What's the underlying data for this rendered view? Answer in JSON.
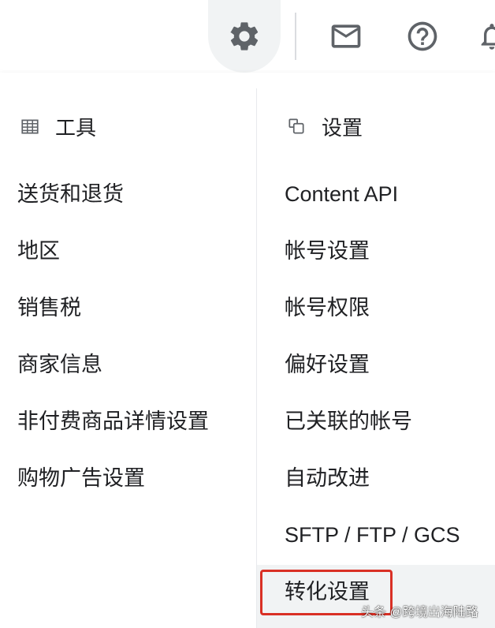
{
  "topbar": {
    "icons": [
      "gear-icon",
      "mail-icon",
      "help-icon",
      "bell-icon"
    ]
  },
  "tools": {
    "header": "工具",
    "items": [
      "送货和退货",
      "地区",
      "销售税",
      "商家信息",
      "非付费商品详情设置",
      "购物广告设置"
    ]
  },
  "settings": {
    "header": "设置",
    "items": [
      "Content API",
      "帐号设置",
      "帐号权限",
      "偏好设置",
      "已关联的帐号",
      "自动改进",
      "SFTP / FTP / GCS",
      "转化设置"
    ]
  },
  "highlight": {
    "selected_item": "转化设置",
    "box_color": "#d93025"
  },
  "watermark": "头条 @跨境出海陆路",
  "colors": {
    "text": "#202124",
    "icon": "#5f6368",
    "active_bg": "#f1f3f4",
    "divider": "#dadce0"
  }
}
